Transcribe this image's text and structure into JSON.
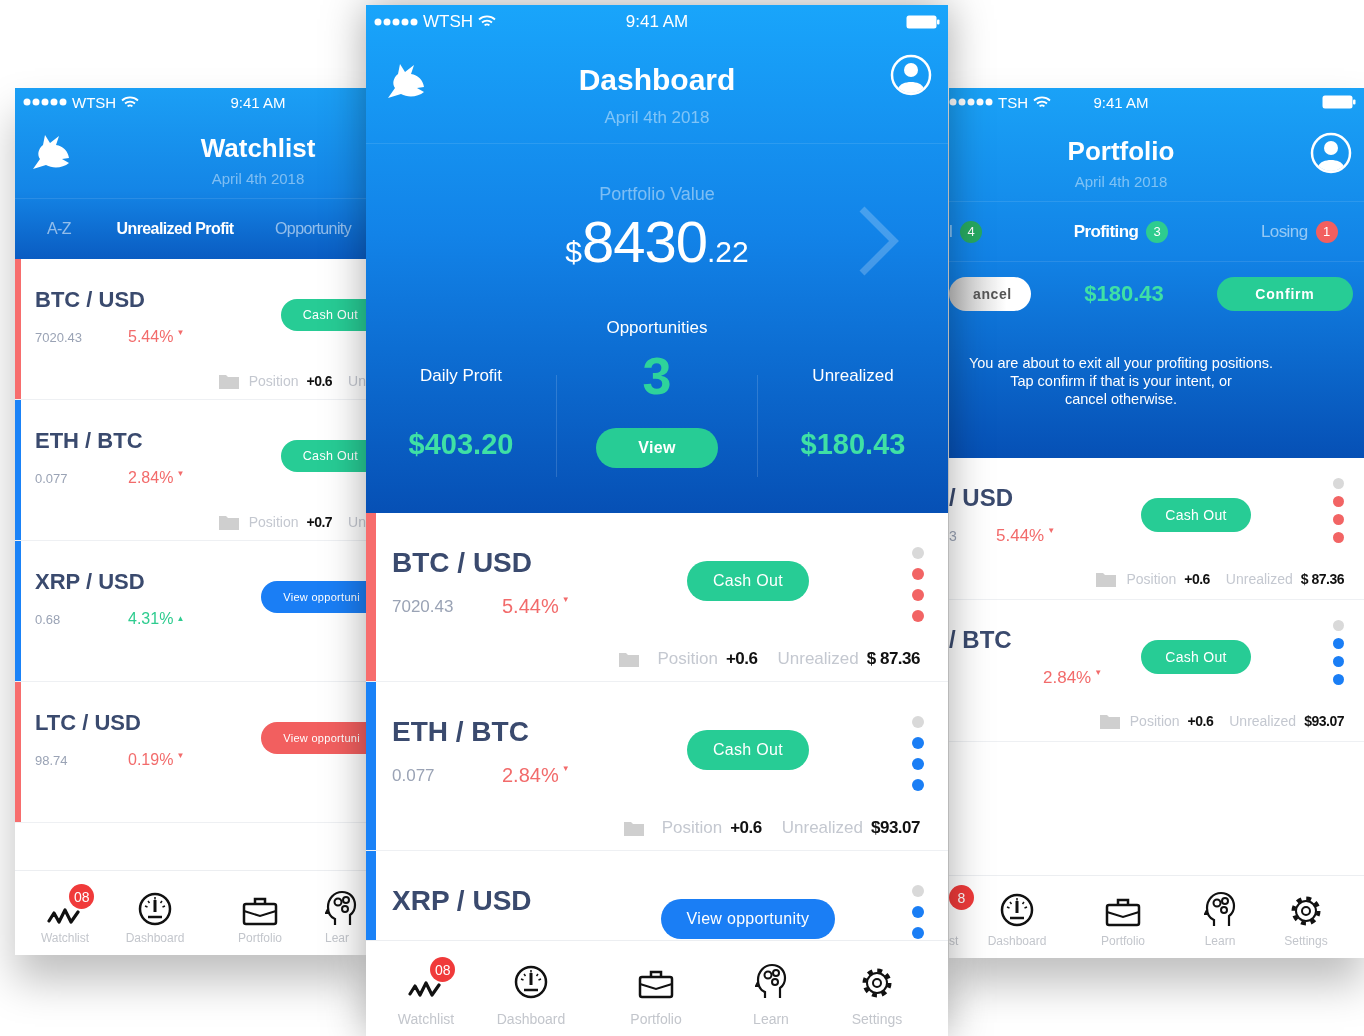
{
  "watchlist": {
    "status": {
      "carrier": "WTSH",
      "time": "9:41 AM"
    },
    "title": "Watchlist",
    "date": "April 4th 2018",
    "tabs": [
      {
        "label": "A-Z",
        "selected": false
      },
      {
        "label": "Unrealized Profit",
        "selected": true
      },
      {
        "label": "Opportunity",
        "selected": false
      }
    ],
    "rows": [
      {
        "pair": "BTC / USD",
        "price": "7020.43",
        "change": "5.44%",
        "rising": false,
        "arrow": "▼",
        "color": "#f76d6d",
        "action": {
          "kind": "cash-out",
          "label": "Cash Out"
        },
        "position_label": "Position",
        "position": "+0.6",
        "unrealized_label": "Un"
      },
      {
        "pair": "ETH / BTC",
        "price": "0.077",
        "change": "2.84%",
        "rising": false,
        "arrow": "▼",
        "color": "#1a82f7",
        "action": {
          "kind": "cash-out",
          "label": "Cash Out"
        },
        "position_label": "Position",
        "position": "+0.7",
        "unrealized_label": "Un"
      },
      {
        "pair": "XRP / USD",
        "price": "0.68",
        "change": "4.31%",
        "rising": true,
        "arrow": "▲",
        "color": "#1a82f7",
        "action": {
          "kind": "opportunity",
          "label": "View opportuni",
          "color": "#1a7ef5"
        }
      },
      {
        "pair": "LTC / USD",
        "price": "98.74",
        "change": "0.19%",
        "rising": false,
        "arrow": "▼",
        "color": "#f76d6d",
        "action": {
          "kind": "opportunity",
          "label": "View opportuni",
          "color": "#f25f5f"
        }
      }
    ],
    "nav": [
      {
        "kind": "wave",
        "label": "Watchlist",
        "badge": "08"
      },
      {
        "kind": "gauge",
        "label": "Dashboard"
      },
      {
        "kind": "briefcase",
        "label": "Portfolio"
      },
      {
        "kind": "head",
        "label": "Lear"
      }
    ]
  },
  "dashboard": {
    "status": {
      "carrier": "WTSH",
      "time": "9:41 AM"
    },
    "title": "Dashboard",
    "date": "April 4th 2018",
    "portfolio_value": {
      "label": "Portfolio Value",
      "currency": "$",
      "whole": "8430",
      "fraction": ".22"
    },
    "opportunities": {
      "label": "Opportunities",
      "count": "3",
      "button": "View"
    },
    "daily_profit": {
      "label": "Daily Profit",
      "value": "$403.20"
    },
    "unrealized": {
      "label": "Unrealized",
      "value": "$180.43"
    },
    "rows": [
      {
        "pair": "BTC / USD",
        "price": "7020.43",
        "change": "5.44%",
        "rising": false,
        "arrow": "▼",
        "color": "#f76d6d",
        "action": {
          "kind": "cash-out",
          "label": "Cash Out"
        },
        "dots": [
          {
            "color": "#d9d9d9"
          },
          {
            "color": "#f26464"
          },
          {
            "color": "#f26464"
          },
          {
            "color": "#f26464"
          }
        ],
        "position_label": "Position",
        "position": "+0.6",
        "unrealized_label": "Unrealized",
        "unrealized": "$ 87.36"
      },
      {
        "pair": "ETH / BTC",
        "price": "0.077",
        "change": "2.84%",
        "rising": false,
        "arrow": "▼",
        "color": "#1a82f7",
        "action": {
          "kind": "cash-out",
          "label": "Cash Out"
        },
        "dots": [
          {
            "color": "#d9d9d9"
          },
          {
            "color": "#1a7ef5"
          },
          {
            "color": "#1a7ef5"
          },
          {
            "color": "#1a7ef5"
          }
        ],
        "position_label": "Position",
        "position": "+0.6",
        "unrealized_label": "Unrealized",
        "unrealized": "$93.07"
      },
      {
        "pair": "XRP / USD",
        "color": "#1a82f7",
        "action": {
          "kind": "opportunity",
          "label": "View opportunity",
          "color": "#1a7ef5"
        },
        "dots": [
          {
            "color": "#d9d9d9"
          },
          {
            "color": "#1a7ef5"
          },
          {
            "color": "#1a7ef5"
          }
        ]
      }
    ],
    "nav": [
      {
        "kind": "wave",
        "label": "Watchlist",
        "badge": "08"
      },
      {
        "kind": "gauge",
        "label": "Dashboard"
      },
      {
        "kind": "briefcase",
        "label": "Portfolio"
      },
      {
        "kind": "head",
        "label": "Learn"
      },
      {
        "kind": "gear",
        "label": "Settings"
      }
    ]
  },
  "portfolio": {
    "status": {
      "carrier": "TSH",
      "time": "9:41 AM"
    },
    "title": "Portfolio",
    "date": "April 4th 2018",
    "tabs": [
      {
        "label": "l",
        "count": "4",
        "color": "#27a860",
        "selected": false
      },
      {
        "label": "Profiting",
        "count": "3",
        "color": "#2ecc8f",
        "selected": true
      },
      {
        "label": "Losing",
        "count": "1",
        "color": "#f25f5f",
        "selected": false
      }
    ],
    "cancel": "ancel",
    "amount": "$180.43",
    "confirm": "Confirm",
    "message": "You are about to exit all your profiting positions.\nTap confirm if that is your intent, or\ncancel otherwise.",
    "rows": [
      {
        "pair": "/ USD",
        "price": "3",
        "change": "5.44%",
        "rising": false,
        "arrow": "▼",
        "action": {
          "kind": "cash-out",
          "label": "Cash Out"
        },
        "dots": [
          {
            "color": "#d9d9d9"
          },
          {
            "color": "#f26464"
          },
          {
            "color": "#f26464"
          },
          {
            "color": "#f26464"
          }
        ],
        "position_label": "Position",
        "position": "+0.6",
        "unrealized_label": "Unrealized",
        "unrealized": "$ 87.36"
      },
      {
        "pair": "/ BTC",
        "change": "2.84%",
        "rising": false,
        "arrow": "▼",
        "action": {
          "kind": "cash-out",
          "label": "Cash Out"
        },
        "dots": [
          {
            "color": "#d9d9d9"
          },
          {
            "color": "#1a7ef5"
          },
          {
            "color": "#1a7ef5"
          },
          {
            "color": "#1a7ef5"
          }
        ],
        "position_label": "Position",
        "position": "+0.6",
        "unrealized_label": "Unrealized",
        "unrealized": "$93.07"
      }
    ],
    "nav": [
      {
        "label": "st",
        "badge": "8"
      },
      {
        "kind": "gauge",
        "label": "Dashboard"
      },
      {
        "kind": "briefcase",
        "label": "Portfolio"
      },
      {
        "kind": "head",
        "label": "Learn"
      },
      {
        "kind": "gear",
        "label": "Settings"
      }
    ]
  }
}
